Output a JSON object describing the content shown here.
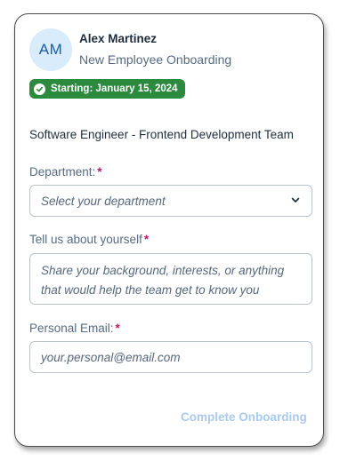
{
  "header": {
    "avatar_initials": "AM",
    "name": "Alex Martinez",
    "subtitle": "New Employee Onboarding"
  },
  "badge": {
    "text": "Starting: January 15, 2024",
    "icon": "check-circle-icon",
    "color": "#2b8a3e"
  },
  "role": "Software Engineer - Frontend Development Team",
  "form": {
    "department": {
      "label": "Department:",
      "required_marker": "*",
      "placeholder": "Select your department",
      "icon": "chevron-down-icon"
    },
    "about": {
      "label": "Tell us about yourself",
      "required_marker": "*",
      "placeholder": "Share your background, interests, or anything that would help the team get to know you"
    },
    "email": {
      "label": "Personal Email:",
      "required_marker": "*",
      "placeholder": "your.personal@email.com"
    }
  },
  "actions": {
    "complete_label": "Complete Onboarding"
  },
  "colors": {
    "accent": "#1a5ea8",
    "required": "#c0176b",
    "disabled_button_text": "#a9c9ef"
  }
}
